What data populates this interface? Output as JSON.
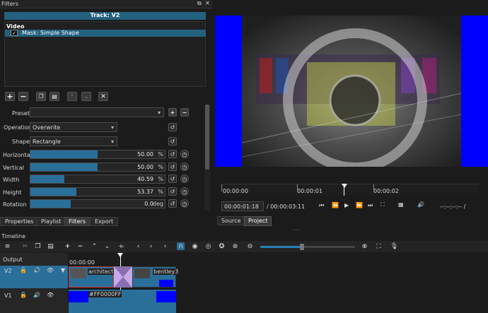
{
  "filters_panel": {
    "title": "Filters",
    "track_label": "Track: V2",
    "section_video": "Video",
    "filter_item": "Mask: Simple Shape",
    "check": "✓"
  },
  "params": {
    "preset_label": "Preset",
    "preset_value": "",
    "operation_label": "Operation",
    "operation_value": "Overwrite",
    "shape_label": "Shape",
    "shape_value": "Rectangle",
    "sliders": [
      {
        "label": "Horizontal",
        "value": "50.00",
        "unit": "%",
        "fraction": 0.5
      },
      {
        "label": "Vertical",
        "value": "50.00",
        "unit": "%",
        "fraction": 0.5
      },
      {
        "label": "Width",
        "value": "40.59",
        "unit": "%",
        "fraction": 0.25
      },
      {
        "label": "Height",
        "value": "53.37",
        "unit": "%",
        "fraction": 0.34
      },
      {
        "label": "Rotation",
        "value": "0.0",
        "unit": "deg",
        "fraction": 0.3
      }
    ]
  },
  "bottom_tabs": [
    "Properties",
    "Playlist",
    "Filters",
    "Export"
  ],
  "player": {
    "ruler": [
      "00:00:00",
      "00:00:01",
      "00:00:02"
    ],
    "current_time": "00:00:01:18",
    "duration": "/ 00:00:03:11",
    "in_out": "--:--:--:-- /",
    "tabs": [
      "Source",
      "Project"
    ],
    "colors": {
      "blue_bar": "#0000ff"
    }
  },
  "timeline": {
    "title": "Timeline",
    "output_label": "Output",
    "ruler_start": "00:00:00",
    "tracks": [
      {
        "name": "V2",
        "clip1": "architectu",
        "clip2": "bentley3"
      },
      {
        "name": "V1",
        "clip1": "#FF0000FF"
      }
    ]
  }
}
